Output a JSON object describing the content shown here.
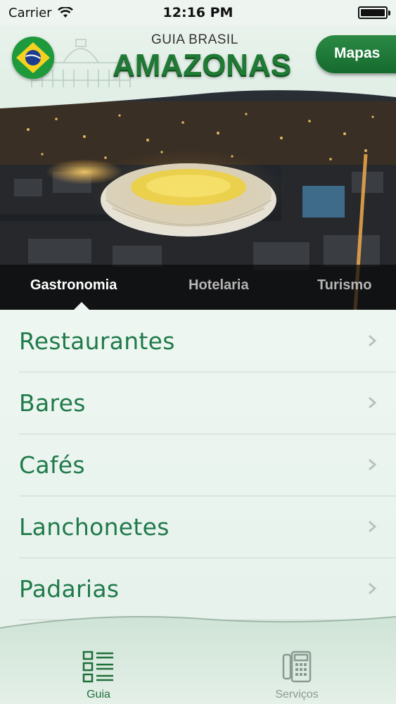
{
  "status_bar": {
    "carrier": "Carrier",
    "time": "12:16 PM"
  },
  "header": {
    "logo_small": "GUIA BRASIL",
    "logo_big": "AMAZONAS",
    "mapas_label": "Mapas"
  },
  "category_tabs": [
    {
      "label": "Gastronomia",
      "active": true
    },
    {
      "label": "Hotelaria",
      "active": false
    },
    {
      "label": "Turismo",
      "active": false
    }
  ],
  "list": {
    "items": [
      {
        "label": "Restaurantes"
      },
      {
        "label": "Bares"
      },
      {
        "label": "Cafés"
      },
      {
        "label": "Lanchonetes"
      },
      {
        "label": "Padarias"
      }
    ]
  },
  "bottom_tabs": [
    {
      "label": "Guia",
      "icon": "guide-list-icon",
      "active": true
    },
    {
      "label": "Serviços",
      "icon": "phone-icon",
      "active": false
    }
  ],
  "colors": {
    "brand_green": "#1f7a34",
    "list_text": "#1f7a4a",
    "inactive_tab": "#8a9a92"
  }
}
